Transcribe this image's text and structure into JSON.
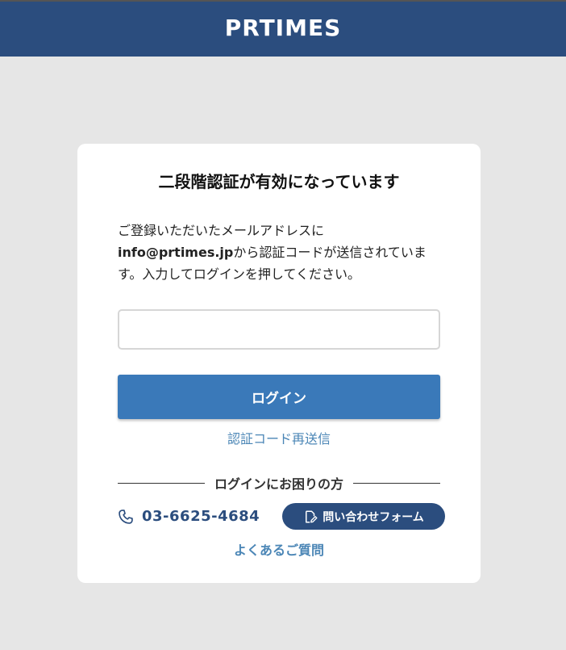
{
  "header": {
    "logo_text": "PRTIMES"
  },
  "card": {
    "title": "二段階認証が有効になっています",
    "description_prefix": "ご登録いただいたメールアドレスに",
    "email": "info@prtimes.jp",
    "description_suffix": "から認証コードが送信されています。入力してログインを押してください。",
    "code_input": {
      "value": "",
      "placeholder": ""
    },
    "login_button_label": "ログイン",
    "resend_link_label": "認証コード再送信",
    "help_heading": "ログインにお困りの方",
    "phone_number": "03-6625-4684",
    "contact_button_label": "問い合わせフォーム",
    "faq_link_label": "よくあるご質問"
  },
  "icons": {
    "phone": "phone-icon",
    "contact": "edit-document-icon"
  },
  "colors": {
    "header_bg": "#2b4d7e",
    "primary_button": "#3a79b9",
    "link": "#4b86b6",
    "page_bg": "#e6e6e6"
  }
}
